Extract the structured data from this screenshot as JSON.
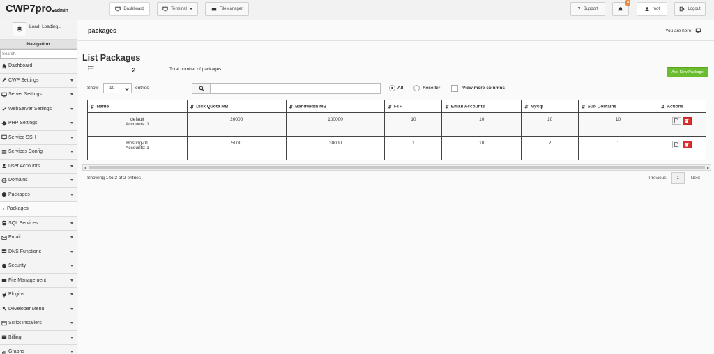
{
  "app": {
    "brand": "CWP7pro.",
    "brand_suffix": "admin"
  },
  "topbar": {
    "dashboard": "Dashboard",
    "terminal": "Terminal",
    "filemanager": "FileManager",
    "support": "Support",
    "notifications_count": "0",
    "user": "root",
    "logout": "Logout"
  },
  "sidebar": {
    "load_text": "Load: Loading...",
    "nav_title": "Navigation",
    "search_placeholder": "Search..",
    "items": [
      {
        "label": "Dashboard",
        "icon": "home-icon"
      },
      {
        "label": "CWP Settings",
        "icon": "wrench-icon"
      },
      {
        "label": "Server Settings",
        "icon": "monitor-icon"
      },
      {
        "label": "WebServer Settings",
        "icon": "check-icon"
      },
      {
        "label": "PHP Settings",
        "icon": "gear-icon"
      },
      {
        "label": "Service SSH",
        "icon": "monitor-icon"
      },
      {
        "label": "Services Config",
        "icon": "server-icon"
      },
      {
        "label": "User Accounts",
        "icon": "user-icon"
      },
      {
        "label": "Domains",
        "icon": "globe-icon"
      },
      {
        "label": "Packages",
        "icon": "box-icon"
      },
      {
        "label": "Packages",
        "icon": "triangle-icon"
      },
      {
        "label": "SQL Services",
        "icon": "database-icon"
      },
      {
        "label": "Email",
        "icon": "envelope-icon"
      },
      {
        "label": "DNS Functions",
        "icon": "dns-icon"
      },
      {
        "label": "Security",
        "icon": "shield-icon"
      },
      {
        "label": "File Management",
        "icon": "folder-icon"
      },
      {
        "label": "Plugins",
        "icon": "plug-icon"
      },
      {
        "label": "Developer Menu",
        "icon": "hammer-icon"
      },
      {
        "label": "Script Installers",
        "icon": "script-icon"
      },
      {
        "label": "Billing",
        "icon": "card-icon"
      },
      {
        "label": "Graphs",
        "icon": "chart-icon"
      }
    ]
  },
  "breadcrumb": {
    "title": "packages",
    "you_are_here": "You are here:"
  },
  "main": {
    "title": "List Packages",
    "count": "2",
    "total_label": "Total number of packages:",
    "add_button": "Add New Package",
    "show_label": "Show",
    "entries_value": "10",
    "entries_label": "entries",
    "search_value": "",
    "filter_all": "All",
    "filter_reseller": "Reseller",
    "view_more": "View more columns",
    "showing": "Showing 1 to 2 of 2 entries",
    "prev": "Previous",
    "page": "1",
    "next": "Next"
  },
  "table": {
    "headers": [
      "Name",
      "Disk Quota MB",
      "Bandwidth MB",
      "FTP",
      "Email Accounts",
      "Mysql",
      "Sub Domains",
      "Actions"
    ],
    "rows": [
      {
        "name": "default",
        "accounts": "Accounts: 1",
        "disk": "20000",
        "bandwidth": "100000",
        "ftp": "10",
        "email": "10",
        "mysql": "10",
        "subdomains": "10"
      },
      {
        "name": "Hosting-01",
        "accounts": "Accounts: 1",
        "disk": "5000",
        "bandwidth": "30000",
        "ftp": "1",
        "email": "10",
        "mysql": "2",
        "subdomains": "1"
      }
    ]
  },
  "colors": {
    "add_button": "#6bbd2f",
    "delete": "#d9302f",
    "badge": "#f0883a"
  }
}
